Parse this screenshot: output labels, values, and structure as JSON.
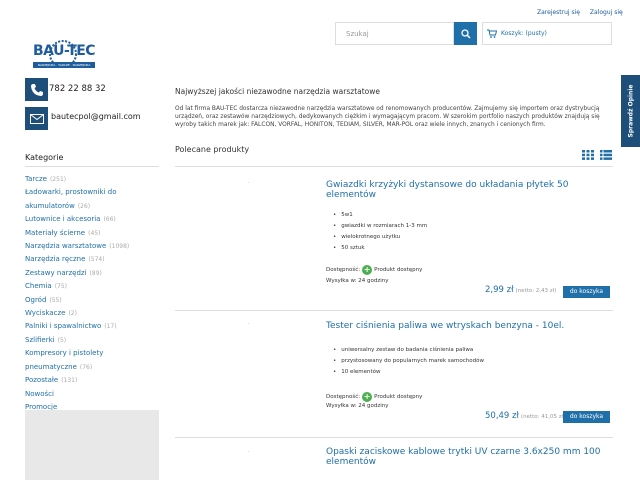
{
  "header": {
    "register_label": "Zarejestruj się",
    "login_label": "Zaloguj się",
    "search_placeholder": "Szukaj",
    "cart_label": "Koszyk: (pusty)"
  },
  "logo": {
    "text": "BAU-TEC",
    "subtext": "NARZĘDZIA · TARCZE · NARZĘDZIA"
  },
  "contact": {
    "phone": "782 22 88 32",
    "email": "bautecpol@gmail.com"
  },
  "sidebar": {
    "title": "Kategorie",
    "categories": [
      {
        "label": "Tarcze",
        "count": "(251)"
      },
      {
        "label": "Ładowarki, prostowniki do",
        "count": ""
      },
      {
        "label": "akumulatorów",
        "count": "(26)"
      },
      {
        "label": "Lutownice i akcesoria",
        "count": "(66)"
      },
      {
        "label": "Materiały ścierne",
        "count": "(45)"
      },
      {
        "label": "Narzędzia warsztatowe",
        "count": "(1098)"
      },
      {
        "label": "Narzędzia ręczne",
        "count": "(574)"
      },
      {
        "label": "Zestawy narzędzi",
        "count": "(89)"
      },
      {
        "label": "Chemia",
        "count": "(75)"
      },
      {
        "label": "Ogród",
        "count": "(55)"
      },
      {
        "label": "Wyciskacze",
        "count": "(2)"
      },
      {
        "label": "Palniki i spawalnictwo",
        "count": "(17)"
      },
      {
        "label": "Szlifierki",
        "count": "(5)"
      },
      {
        "label": "Kompresory i pistolety",
        "count": ""
      },
      {
        "label": "pneumatyczne",
        "count": "(76)"
      },
      {
        "label": "Pozostałe",
        "count": "(131)"
      },
      {
        "label": "Nowości",
        "count": ""
      },
      {
        "label": "Promocje",
        "count": ""
      }
    ]
  },
  "main": {
    "headline": "Najwyższej jakości niezawodne narzędzia warsztatowe",
    "intro": "Od lat firma BAU-TEC dostarcza niezawodne narzędzia warsztatowe od renomowanych producentów. Zajmujemy się importem oraz dystrybucją urządzeń, oraz zestawów narzędziowych, dedykowanych ciężkim i wymagającym pracom. W szerokim portfolio naszych produktów znajdują się wyroby takich marek jak: FALCON, VORFAL, HONITON, TEDIAM, SILVER, MAR-POL oraz wiele innych, znanych i cenionych firm.",
    "featured_title": "Polecane produkty"
  },
  "products": [
    {
      "title": "Gwiazdki krzyżyki dystansowe do układania płytek 50 elementów",
      "bullets": [
        "5w1",
        "gwiazdki w rozmiarach 1-3 mm",
        "wielokrotnego użytku",
        "50 sztuk"
      ],
      "availability_label": "Dostępność:",
      "availability_value": "Produkt dostępny",
      "shipping": "Wysyłka w: 24 godziny",
      "price": "2,99 zł",
      "price_net": "(netto: 2,43 zł)",
      "button": "do koszyka"
    },
    {
      "title": "Tester ciśnienia paliwa we wtryskach benzyna - 10el.",
      "bullets": [
        "uniwersalny zestaw do badania ciśnienia paliwa",
        "przystosowany do popularnych marek samochodów",
        "10 elementów"
      ],
      "availability_label": "Dostępność:",
      "availability_value": "Produkt dostępny",
      "shipping": "Wysyłka w: 24 godziny",
      "price": "50,49 zł",
      "price_net": "(netto: 41,05 zł)",
      "button": "do koszyka"
    },
    {
      "title": "Opaski zaciskowe kablowe trytki UV czarne 3.6x250 mm 100 elementów"
    }
  ],
  "side_tab": {
    "label": "Sprawdź Opinie"
  },
  "colors": {
    "accent": "#1f6fa8",
    "dark_blue": "#1e4f7a",
    "available_green": "#4caf50"
  }
}
